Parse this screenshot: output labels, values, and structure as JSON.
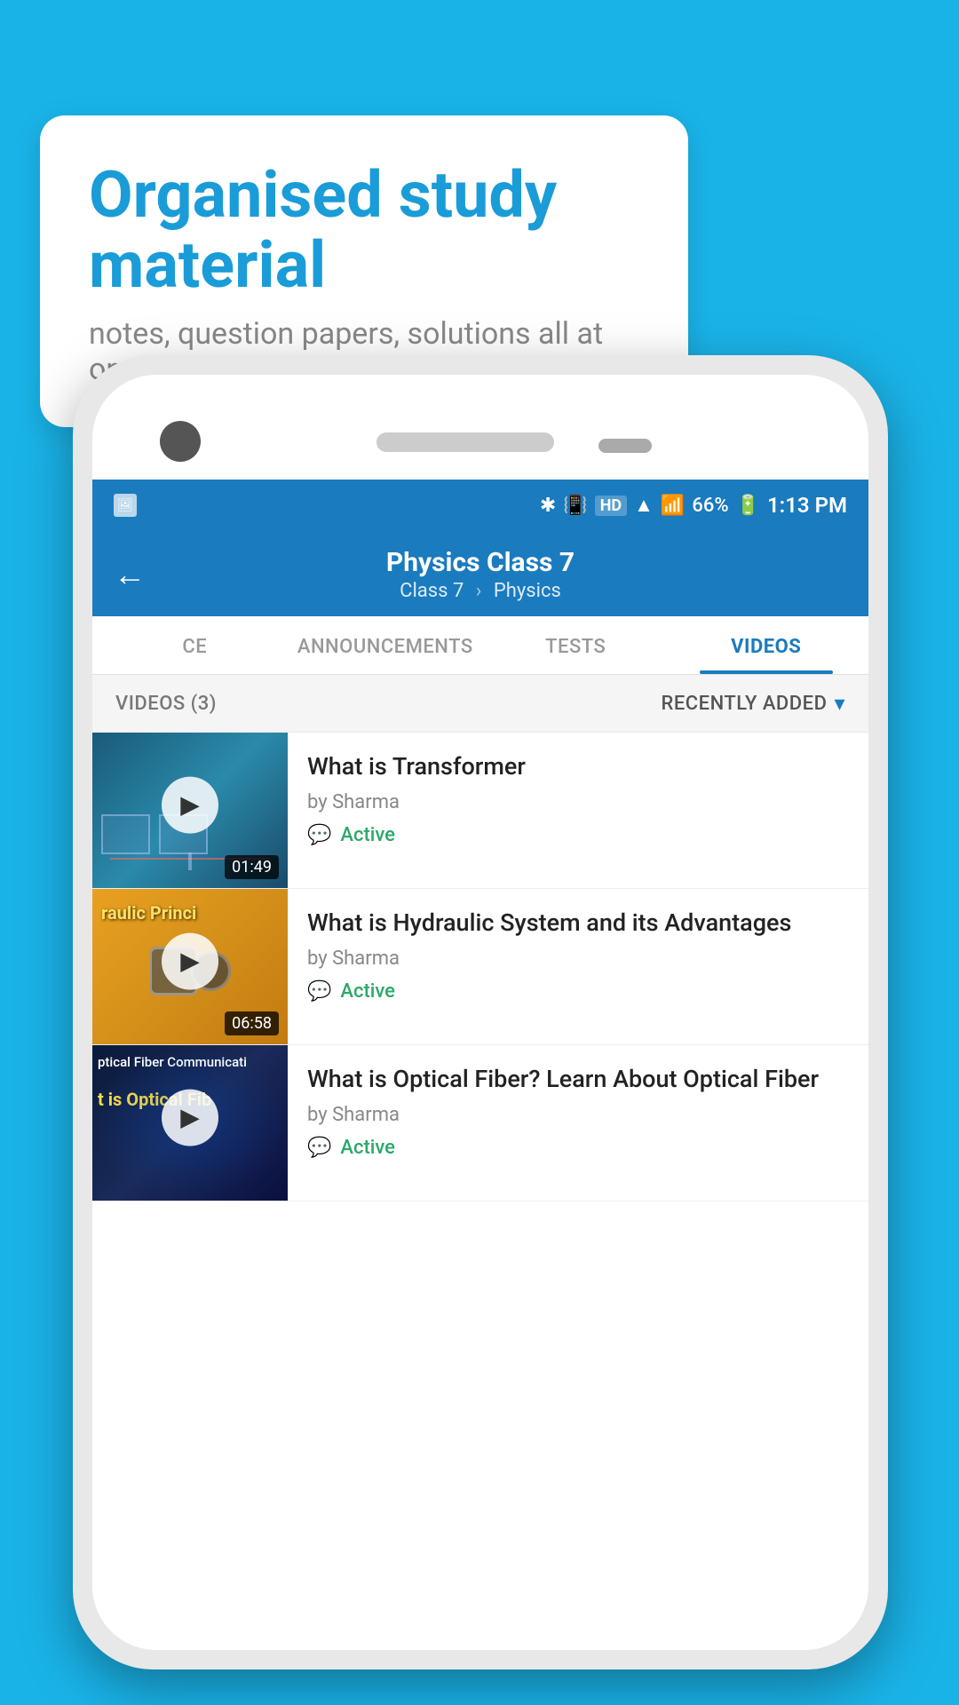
{
  "background_color": "#1ab3e8",
  "bubble": {
    "title": "Organised study material",
    "subtitle": "notes, question papers, solutions all at one place"
  },
  "status_bar": {
    "battery": "66%",
    "time": "1:13 PM",
    "signal_text": "HD"
  },
  "app_bar": {
    "back_label": "←",
    "title": "Physics Class 7",
    "breadcrumb_class": "Class 7",
    "breadcrumb_sep": "›",
    "breadcrumb_subject": "Physics"
  },
  "tabs": [
    {
      "id": "ce",
      "label": "CE",
      "active": false
    },
    {
      "id": "announcements",
      "label": "ANNOUNCEMENTS",
      "active": false
    },
    {
      "id": "tests",
      "label": "TESTS",
      "active": false
    },
    {
      "id": "videos",
      "label": "VIDEOS",
      "active": true
    }
  ],
  "videos_section": {
    "header_count": "VIDEOS (3)",
    "sort_label": "RECENTLY ADDED",
    "sort_icon": "▾"
  },
  "videos": [
    {
      "id": 1,
      "title": "What is  Transformer",
      "author": "by Sharma",
      "status": "Active",
      "duration": "01:49",
      "thumb_label": "",
      "thumb_color": "dark-blue"
    },
    {
      "id": 2,
      "title": "What is Hydraulic System and its Advantages",
      "author": "by Sharma",
      "status": "Active",
      "duration": "06:58",
      "thumb_label": "raulic Princi",
      "thumb_color": "yellow"
    },
    {
      "id": 3,
      "title": "What is Optical Fiber? Learn About Optical Fiber",
      "author": "by Sharma",
      "status": "Active",
      "duration": "",
      "thumb_label1": "ptical Fiber Communicati",
      "thumb_label2": "t is Optical Fib",
      "thumb_color": "dark"
    }
  ]
}
